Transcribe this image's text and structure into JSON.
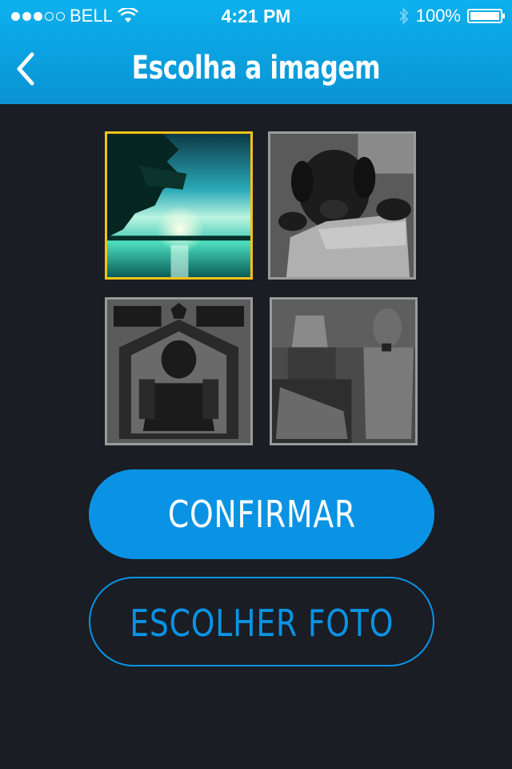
{
  "status_bar": {
    "carrier": "BELL",
    "time": "4:21 PM",
    "battery": "100%",
    "signal_bars": 3,
    "signal_total": 5
  },
  "header": {
    "title": "Escolha a imagem",
    "back_icon": "chevron-left-icon"
  },
  "gallery": {
    "images": [
      {
        "name": "sunset-lake-photo",
        "selected": true
      },
      {
        "name": "puppy-hand-photo",
        "selected": false
      },
      {
        "name": "wild-world-lion-poster",
        "selected": false
      },
      {
        "name": "robot-figures-photo",
        "selected": false
      }
    ]
  },
  "actions": {
    "confirm_label": "CONFIRMAR",
    "choose_photo_label": "ESCOLHER FOTO"
  },
  "colors": {
    "accent": "#0a93e4",
    "header": "#0cb1ee",
    "background": "#1a1d24",
    "selected_border": "#f3c21a"
  }
}
